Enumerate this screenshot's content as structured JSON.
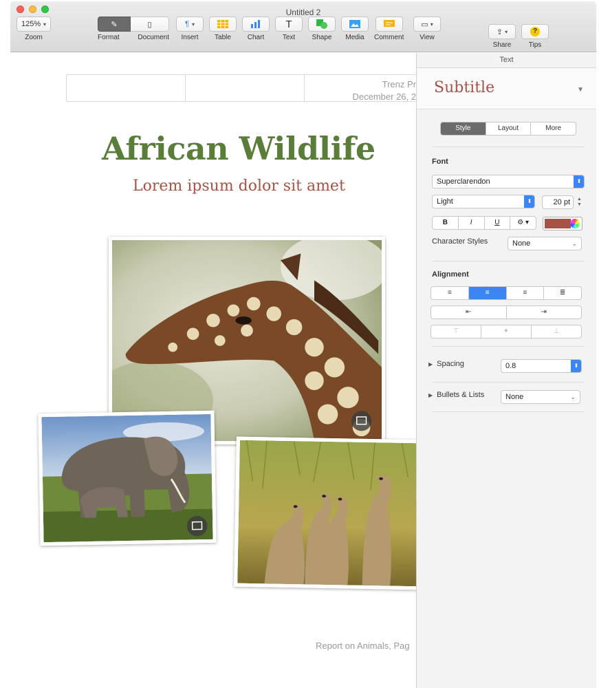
{
  "window": {
    "title": "Untitled 2"
  },
  "toolbar": {
    "zoom_value": "125%",
    "zoom_label": "Zoom",
    "format_label": "Format",
    "document_label": "Document",
    "insert_label": "Insert",
    "table_label": "Table",
    "chart_label": "Chart",
    "text_label": "Text",
    "shape_label": "Shape",
    "media_label": "Media",
    "comment_label": "Comment",
    "view_label": "View",
    "share_label": "Share",
    "tips_label": "Tips",
    "text_glyph": "T",
    "tips_glyph": "?"
  },
  "document": {
    "header_company": "Trenz Pr",
    "header_date": "December 26, 2",
    "title": "African Wildlife",
    "subtitle": "Lorem ipsum dolor sit amet",
    "footer": "Report on Animals, Pag",
    "photos": [
      "giraffe",
      "elephants",
      "meerkats"
    ]
  },
  "inspector": {
    "header": "Text",
    "paragraph_style": "Subtitle",
    "tabs": {
      "style": "Style",
      "layout": "Layout",
      "more": "More"
    },
    "font": {
      "section_label": "Font",
      "family": "Superclarendon",
      "typeface": "Light",
      "size": "20 pt",
      "bold": "B",
      "italic": "I",
      "underline": "U",
      "text_color": "#a65245"
    },
    "character_styles": {
      "label": "Character Styles",
      "value": "None"
    },
    "alignment": {
      "label": "Alignment",
      "selected": "center"
    },
    "spacing": {
      "label": "Spacing",
      "value": "0.8"
    },
    "bullets": {
      "label": "Bullets & Lists",
      "value": "None"
    }
  },
  "colors": {
    "title_green": "#5a7d3a",
    "subtitle_red": "#a65245",
    "accent_blue": "#3b86f3"
  }
}
